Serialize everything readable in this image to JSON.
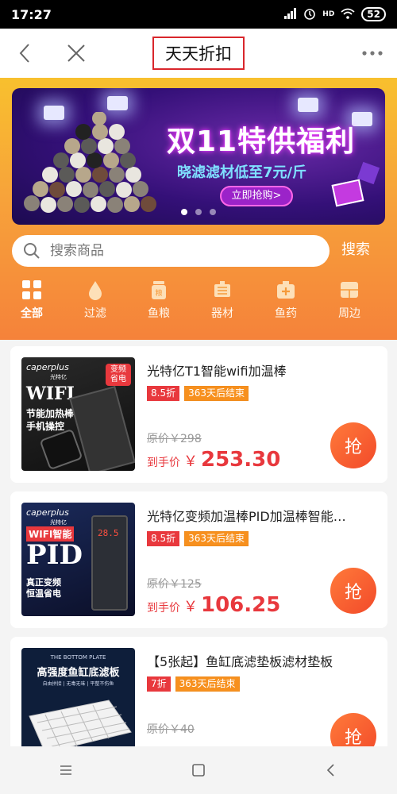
{
  "status_bar": {
    "time": "17:27",
    "battery": "52",
    "network": "HD"
  },
  "nav": {
    "title": "天天折扣"
  },
  "banner": {
    "title": "双11特供福利",
    "subtitle": "晓滤滤材低至7元/斤",
    "button": "立即抢购>"
  },
  "search": {
    "placeholder": "搜索商品",
    "button": "搜索"
  },
  "categories": [
    {
      "label": "全部",
      "icon": "grid-icon"
    },
    {
      "label": "过滤",
      "icon": "water-drop-icon"
    },
    {
      "label": "鱼粮",
      "icon": "food-jar-icon"
    },
    {
      "label": "器材",
      "icon": "equipment-icon"
    },
    {
      "label": "鱼药",
      "icon": "medicine-box-icon"
    },
    {
      "label": "周边",
      "icon": "accessory-icon"
    }
  ],
  "products": [
    {
      "name": "光特亿T1智能wifi加温棒",
      "discount": "8.5折",
      "ends": "363天后结束",
      "orig": "原价￥298",
      "final_label": "到手价",
      "currency": "￥",
      "price": "253.30",
      "grab": "抢",
      "img": {
        "brand": "caperplus",
        "brand_sub": "光特亿",
        "line1": "WIFI",
        "line2": "节能加热棒",
        "line3": "手机操控",
        "badge": "变频省电"
      }
    },
    {
      "name": "光特亿变频加温棒PID加温棒智能…",
      "discount": "8.5折",
      "ends": "363天后结束",
      "orig": "原价￥125",
      "final_label": "到手价",
      "currency": "￥",
      "price": "106.25",
      "grab": "抢",
      "img": {
        "brand": "caperplus",
        "brand_sub": "光特亿",
        "line1": "WIFI智能",
        "line2": "PID",
        "line3": "真正变频",
        "line4": "恒温省电",
        "display": "28.5"
      }
    },
    {
      "name": "【5张起】鱼缸底滤垫板滤材垫板",
      "discount": "7折",
      "ends": "363天后结束",
      "orig": "原价￥40",
      "grab": "抢",
      "img": {
        "line1": "THE BOTTOM PLATE",
        "line2": "高强度鱼缸底滤板",
        "line3": "自由拼接 | 无毒无味 | 平整不伤鱼"
      }
    }
  ],
  "colors": {
    "accent": "#e8383d",
    "orange": "#f7a33a",
    "tag_orange": "#f7901e"
  }
}
